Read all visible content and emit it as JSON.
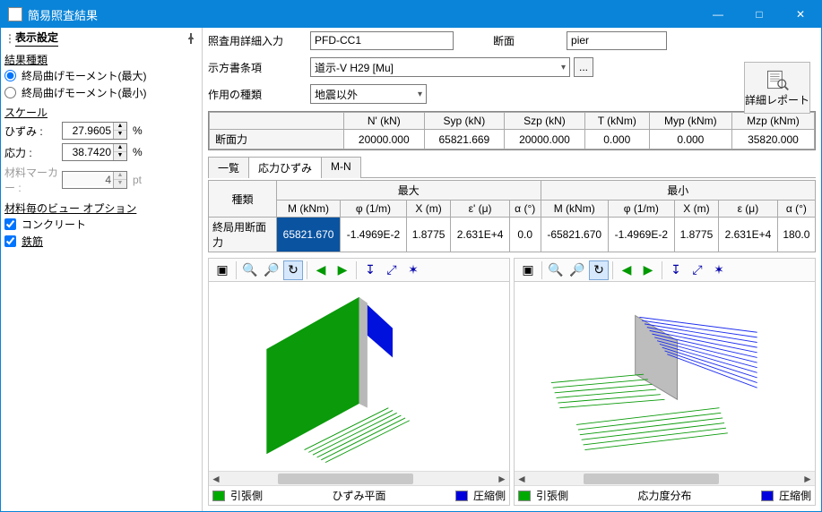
{
  "window": {
    "title": "簡易照査結果"
  },
  "sidebar": {
    "header": "表示設定",
    "result_type_label": "結果種類",
    "result_type_max": "終局曲げモーメント(最大)",
    "result_type_min": "終局曲げモーメント(最小)",
    "scale_label": "スケール",
    "strain_label": "ひずみ :",
    "strain_value": "27.9605",
    "strain_unit": "%",
    "stress_label": "応力 :",
    "stress_value": "38.7420",
    "stress_unit": "%",
    "marker_label": "材料マーカー :",
    "marker_value": "4",
    "marker_unit": "pt",
    "view_option_label": "材料毎のビュー オプション",
    "concrete_label": "コンクリート",
    "rebar_label": "鉄筋"
  },
  "header": {
    "input_label": "照査用詳細入力",
    "input_value": "PFD-CC1",
    "section_label": "断面",
    "section_value": "pier",
    "spec_label": "示方書条項",
    "spec_value": "道示-V H29 [Mu]",
    "spec_btn": "...",
    "action_label": "作用の種類",
    "action_value": "地震以外",
    "report_btn": "詳細レポート"
  },
  "force_table": {
    "cols": [
      "N' (kN)",
      "Syp (kN)",
      "Szp (kN)",
      "T (kNm)",
      "Myp (kNm)",
      "Mzp (kNm)"
    ],
    "row_label": "断面力",
    "values": [
      "20000.000",
      "65821.669",
      "20000.000",
      "0.000",
      "0.000",
      "35820.000"
    ]
  },
  "tabs": {
    "list": "一覧",
    "stress": "応力ひずみ",
    "mn": "M-N"
  },
  "stress_table": {
    "kind_label": "種類",
    "max_label": "最大",
    "min_label": "最小",
    "cols_max": [
      "M (kNm)",
      "φ (1/m)",
      "X (m)",
      "ε' (μ)",
      "α (°)"
    ],
    "cols_min": [
      "M (kNm)",
      "φ (1/m)",
      "X (m)",
      "ε (μ)",
      "α (°)"
    ],
    "row_label": "終局用断面力",
    "max_vals": [
      "65821.670",
      "-1.4969E-2",
      "1.8775",
      "2.631E+4",
      "0.0"
    ],
    "min_vals": [
      "-65821.670",
      "-1.4969E-2",
      "1.8775",
      "2.631E+4",
      "180.0"
    ]
  },
  "legend": {
    "tension": "引張側",
    "compression": "圧縮側",
    "strain_plane": "ひずみ平面",
    "stress_dist": "応力度分布"
  },
  "chart_data": [
    {
      "type": "area",
      "title": "ひずみ平面",
      "series": [
        {
          "name": "引張側",
          "color": "#009900"
        },
        {
          "name": "圧縮側",
          "color": "#0000dd"
        }
      ]
    },
    {
      "type": "area",
      "title": "応力度分布",
      "series": [
        {
          "name": "引張側",
          "color": "#009900"
        },
        {
          "name": "圧縮側",
          "color": "#0000dd"
        }
      ]
    }
  ]
}
